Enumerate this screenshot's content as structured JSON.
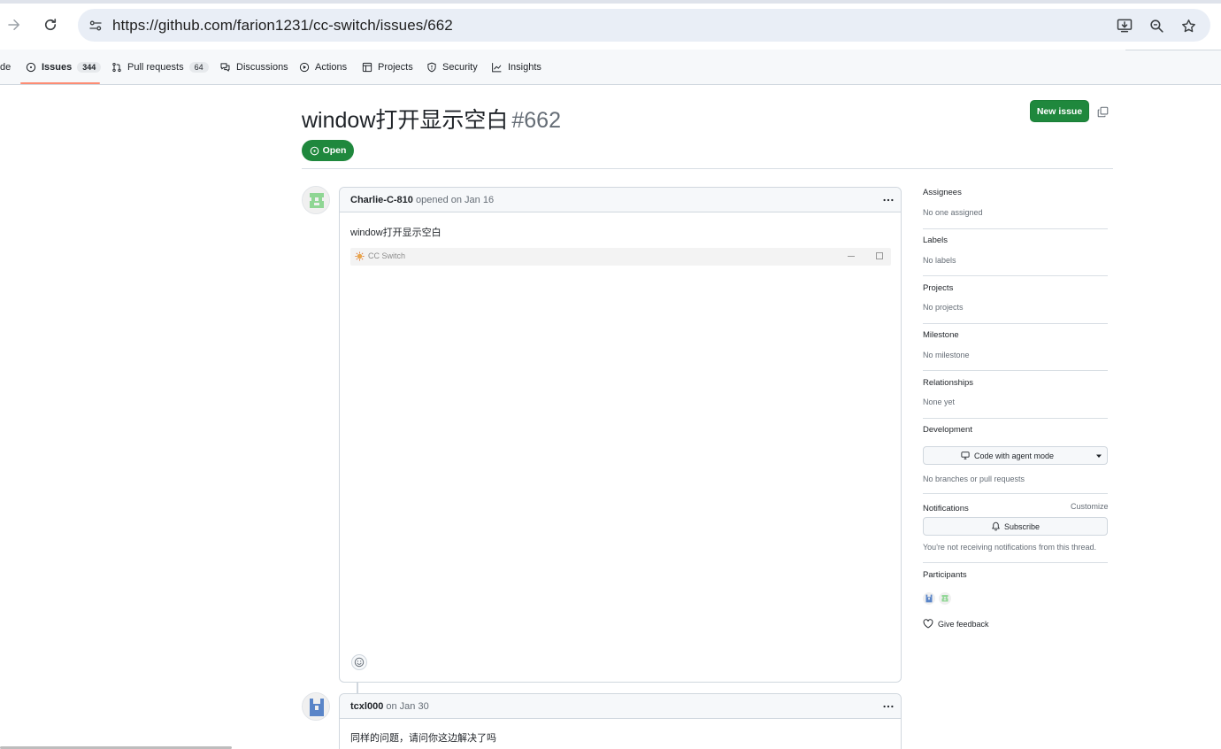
{
  "browser": {
    "url": "https://github.com/farion1231/cc-switch/issues/662"
  },
  "repo_nav": {
    "tabs": [
      {
        "label": "de"
      },
      {
        "label": "Issues",
        "count": "344"
      },
      {
        "label": "Pull requests",
        "count": "64"
      },
      {
        "label": "Discussions"
      },
      {
        "label": "Actions"
      },
      {
        "label": "Projects"
      },
      {
        "label": "Security"
      },
      {
        "label": "Insights"
      }
    ]
  },
  "issue": {
    "title": "window打开显示空白",
    "number": "#662",
    "state": "Open",
    "new_issue_label": "New issue"
  },
  "comments": [
    {
      "author": "Charlie-C-810",
      "meta": " opened on Jan 16",
      "body": "window打开显示空白",
      "embedded_app_title": "CC Switch"
    },
    {
      "author": "tcxl000",
      "meta": " on Jan 30",
      "body": "同样的问题，请问你这边解决了吗"
    }
  ],
  "sidebar": {
    "assignees": {
      "heading": "Assignees",
      "value": "No one assigned"
    },
    "labels": {
      "heading": "Labels",
      "value": "No labels"
    },
    "projects": {
      "heading": "Projects",
      "value": "No projects"
    },
    "milestone": {
      "heading": "Milestone",
      "value": "No milestone"
    },
    "relationships": {
      "heading": "Relationships",
      "value": "None yet"
    },
    "development": {
      "heading": "Development",
      "button": "Code with agent mode",
      "value": "No branches or pull requests"
    },
    "notifications": {
      "heading": "Notifications",
      "customize": "Customize",
      "button": "Subscribe",
      "value": "You're not receiving notifications from this thread."
    },
    "participants": {
      "heading": "Participants"
    },
    "feedback": "Give feedback"
  },
  "colors": {
    "primary_green": "#1f883d",
    "tab_underline": "#fd8c73",
    "muted_text": "#656d76"
  }
}
